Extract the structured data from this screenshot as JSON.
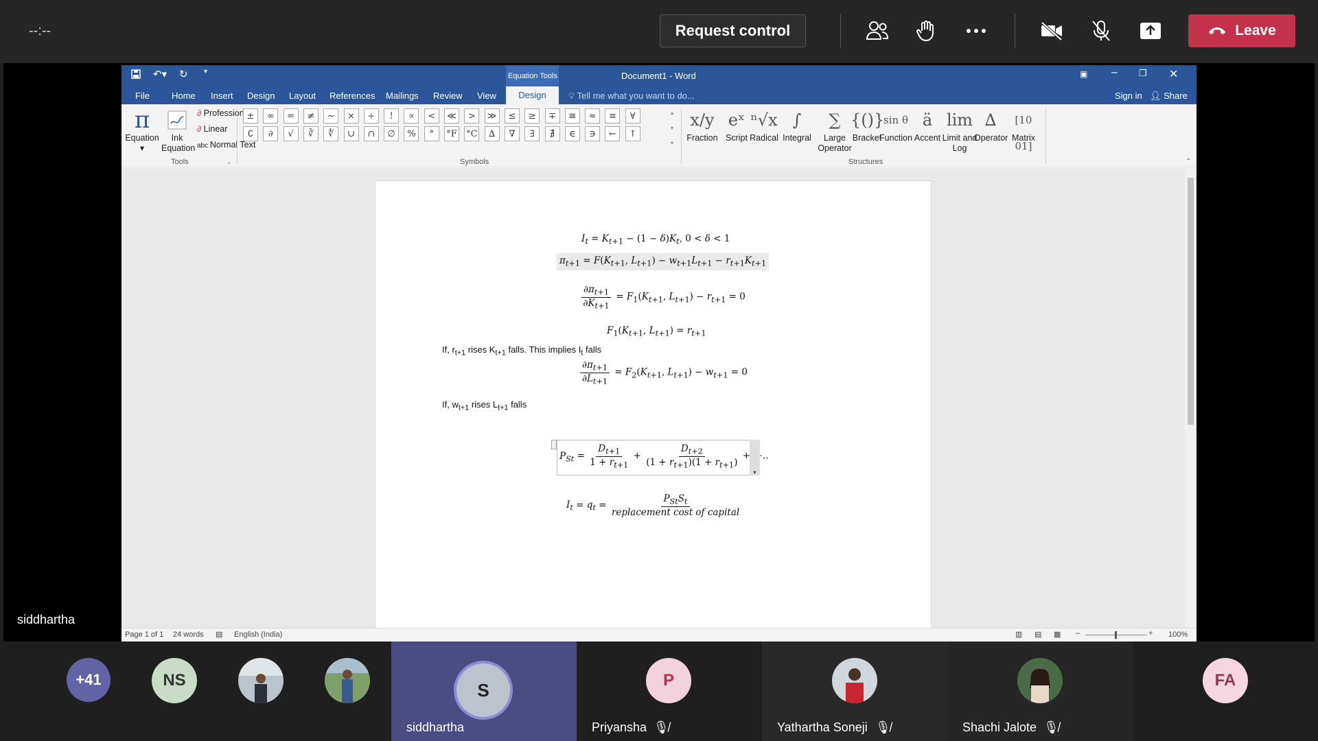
{
  "meeting": {
    "timer": "--:--",
    "request_control": "Request control",
    "leave": "Leave",
    "presenter_label": "siddhartha"
  },
  "word": {
    "title": "Document1 - Word",
    "context_group": "Equation Tools",
    "tabs": [
      "File",
      "Home",
      "Insert",
      "Design",
      "Layout",
      "References",
      "Mailings",
      "Review",
      "View"
    ],
    "active_tab": "Design",
    "tell_me": "Tell me what you want to do...",
    "sign_in": "Sign in",
    "share": "Share",
    "tools": {
      "equation": "Equation",
      "ink_equation_1": "Ink",
      "ink_equation_2": "Equation",
      "professional": "Professional",
      "linear": "Linear",
      "normal_text": "Normal Text",
      "group": "Tools"
    },
    "symbols_row1": [
      "±",
      "∞",
      "=",
      "≠",
      "~",
      "×",
      "÷",
      "!",
      "∝",
      "<",
      "≪",
      ">",
      "≫",
      "≤",
      "≥",
      "∓",
      "≅",
      "≈",
      "≡",
      "∀"
    ],
    "symbols_row2": [
      "∁",
      "∂",
      "√",
      "∛",
      "∜",
      "∪",
      "∩",
      "∅",
      "%",
      "°",
      "°F",
      "°C",
      "∆",
      "∇",
      "∃",
      "∄",
      "∈",
      "∋",
      "←",
      "↑"
    ],
    "symbols_group": "Symbols",
    "structures": [
      {
        "label": "Fraction",
        "glyph": "x/y"
      },
      {
        "label": "Script",
        "glyph": "eˣ"
      },
      {
        "label": "Radical",
        "glyph": "ⁿ√x"
      },
      {
        "label": "Integral",
        "glyph": "∫"
      },
      {
        "label": "Large Operator",
        "glyph": "∑"
      },
      {
        "label": "Bracket",
        "glyph": "{()}"
      },
      {
        "label": "Function",
        "glyph": "sin θ"
      },
      {
        "label": "Accent",
        "glyph": "ä"
      },
      {
        "label": "Limit and Log",
        "glyph": "lim"
      },
      {
        "label": "Operator",
        "glyph": "∆"
      },
      {
        "label": "Matrix",
        "glyph": "[10 01]"
      }
    ],
    "structures_group": "Structures",
    "status": {
      "page": "Page 1 of 1",
      "words": "24 words",
      "language": "English (India)",
      "zoom": "100%"
    }
  },
  "document": {
    "text_if_r": "If, r",
    "text_if_r_rest": " rises K",
    "text_if_r_rest2": " falls. This implies I",
    "text_if_r_end": " falls",
    "text_if_w": "If, w",
    "text_if_w_rest": " rises L",
    "text_if_w_end": " falls",
    "replacement": "replacement cost of capital"
  },
  "participants": {
    "overflow": "+41",
    "ns": "NS",
    "siddhartha_initial": "S",
    "siddhartha": "siddhartha",
    "p_initial": "P",
    "priyansha": "Priyansha",
    "yathartha": "Yathartha Soneji",
    "shachi": "Shachi Jalote",
    "fa": "FA"
  }
}
